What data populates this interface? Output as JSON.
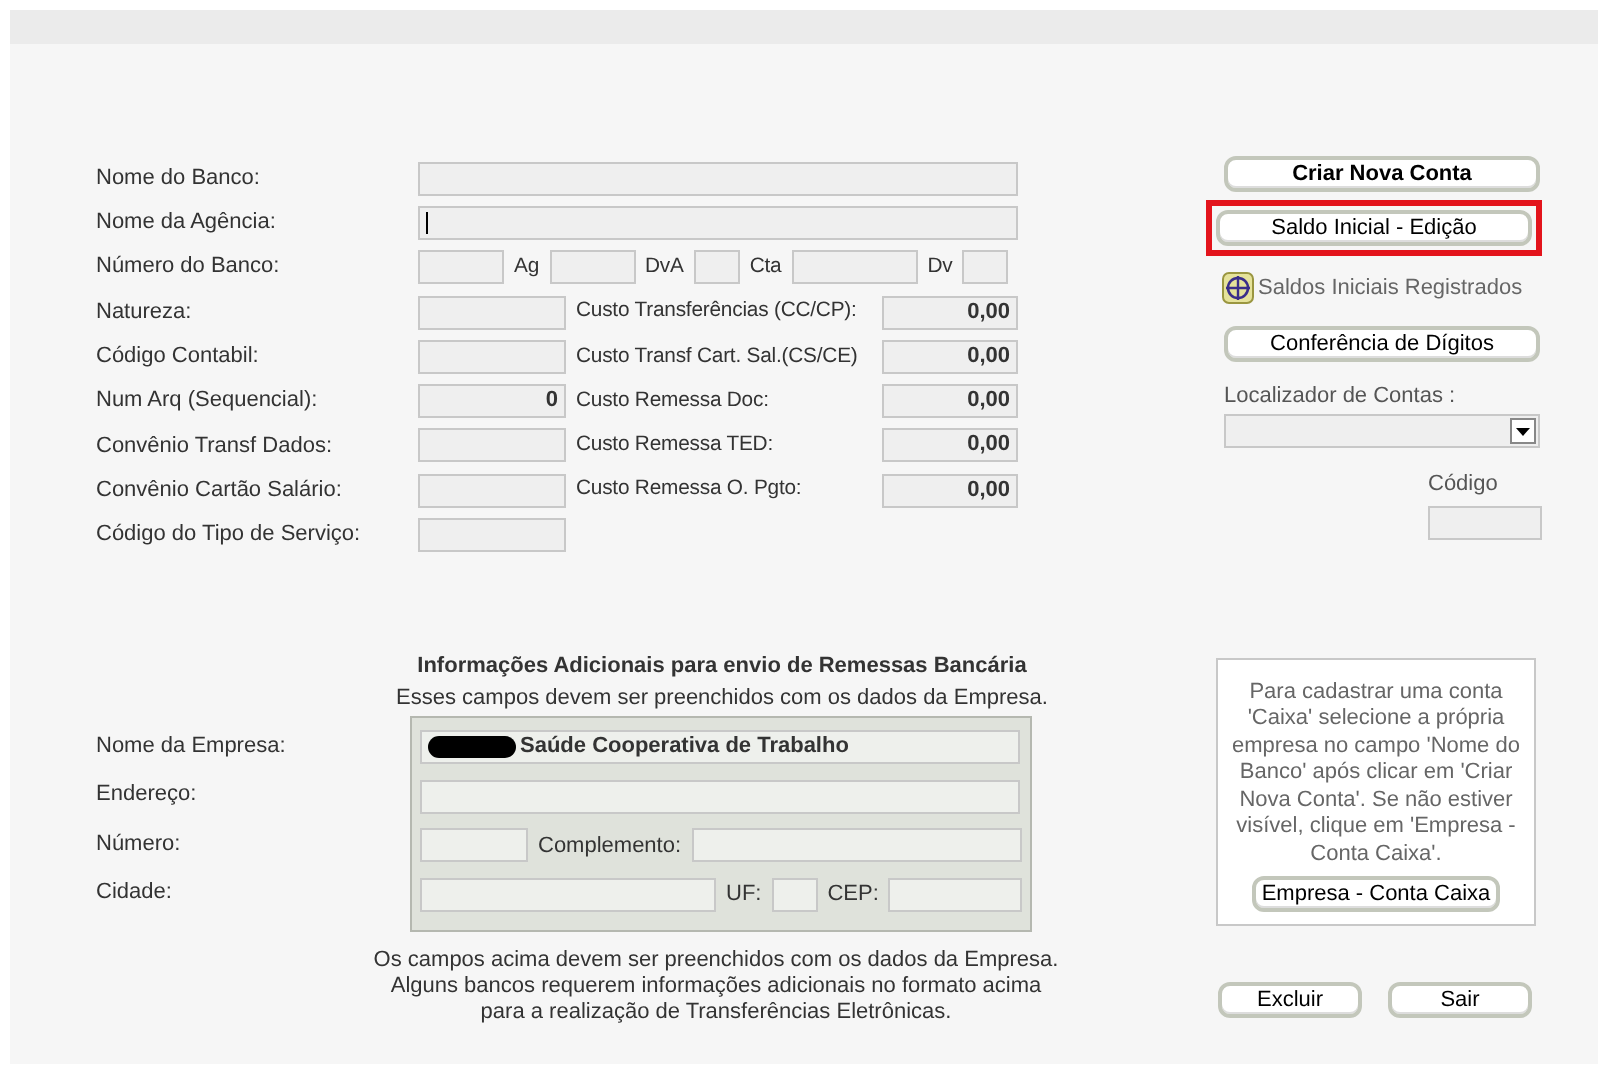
{
  "bank_form": {
    "rows": [
      {
        "label": "Nome do Banco:",
        "items": [
          {
            "kind": "wide"
          }
        ]
      },
      {
        "label": "Nome da Agência:",
        "items": [
          {
            "kind": "wide",
            "focused": true
          }
        ]
      },
      {
        "label": "Número do Banco:",
        "items": [
          {
            "kind": "short"
          },
          {
            "kind": "caption",
            "text": "Ag"
          },
          {
            "kind": "short"
          },
          {
            "kind": "caption",
            "text": "DvA"
          },
          {
            "kind": "tiny"
          },
          {
            "kind": "caption",
            "text": "Cta"
          },
          {
            "kind": "long"
          },
          {
            "kind": "caption",
            "text": "Dv"
          },
          {
            "kind": "tiny"
          }
        ]
      },
      {
        "label": "Natureza:",
        "items": [
          {
            "kind": "medium"
          },
          {
            "kind": "caption",
            "text": "Custo Transferências (CC/CP):"
          },
          {
            "kind": "amount",
            "value": "0,00"
          }
        ]
      },
      {
        "label": "Código Contabil:",
        "items": [
          {
            "kind": "medium"
          },
          {
            "kind": "caption",
            "text": "Custo Transf Cart. Sal.(CS/CE)"
          },
          {
            "kind": "amount",
            "value": "0,00"
          }
        ]
      },
      {
        "label": "Num Arq (Sequencial):",
        "items": [
          {
            "kind": "medium",
            "value": "0"
          },
          {
            "kind": "caption",
            "text": "Custo Remessa Doc:"
          },
          {
            "kind": "amount",
            "value": "0,00"
          }
        ]
      },
      {
        "label": "Convênio Transf Dados:",
        "items": [
          {
            "kind": "medium"
          },
          {
            "kind": "caption",
            "text": "Custo Remessa TED:"
          },
          {
            "kind": "amount",
            "value": "0,00"
          }
        ]
      },
      {
        "label": "Convênio Cartão Salário:",
        "items": [
          {
            "kind": "medium"
          },
          {
            "kind": "caption",
            "text": "Custo Remessa O. Pgto:"
          },
          {
            "kind": "amount",
            "value": "0,00"
          }
        ]
      },
      {
        "label": "Código do Tipo de Serviço:",
        "items": [
          {
            "kind": "medium"
          }
        ]
      }
    ]
  },
  "company_section": {
    "title": "Informações Adicionais para envio de Remessas Bancária",
    "subtitle": "Esses campos devem ser preenchidos com os dados da Empresa.",
    "rows": [
      {
        "label": "Nome da Empresa:",
        "items": [
          {
            "kind": "full",
            "value": "Saúde Cooperativa de Trabalho",
            "redacted": true
          }
        ]
      },
      {
        "label": "Endereço:",
        "items": [
          {
            "kind": "full"
          }
        ]
      },
      {
        "label": "Número:",
        "items": [
          {
            "kind": "num"
          },
          {
            "kind": "caption",
            "text": "Complemento:"
          },
          {
            "kind": "fill"
          }
        ]
      },
      {
        "label": "Cidade:",
        "items": [
          {
            "kind": "city"
          },
          {
            "kind": "caption",
            "text": "UF:"
          },
          {
            "kind": "tiny"
          },
          {
            "kind": "caption",
            "text": "CEP:"
          },
          {
            "kind": "fill"
          }
        ]
      }
    ],
    "note_lines": [
      "Os campos acima devem ser preenchidos com os dados da Empresa.",
      "Alguns bancos requerem informações adicionais no formato acima",
      "para a realização de Transferências Eletrônicas."
    ]
  },
  "side_panel": {
    "top_buttons": [
      {
        "label": "Criar Nova Conta",
        "bold": true,
        "highlighted": false
      },
      {
        "label": "Saldo Inicial - Edição",
        "bold": false,
        "highlighted": true
      }
    ],
    "registered_link": "Saldos Iniciais Registrados",
    "check_button": "Conferência de Dígitos",
    "account_finder_label": "Localizador de Contas :",
    "code_label": "Código",
    "info_box": {
      "text": "Para cadastrar uma conta 'Caixa' selecione a própria empresa no campo 'Nome do Banco' após clicar em 'Criar Nova Conta'. Se não estiver visível, clique em 'Empresa - Conta Caixa'.",
      "button": "Empresa - Conta Caixa"
    },
    "bottom_buttons": [
      "Excluir",
      "Sair"
    ]
  }
}
